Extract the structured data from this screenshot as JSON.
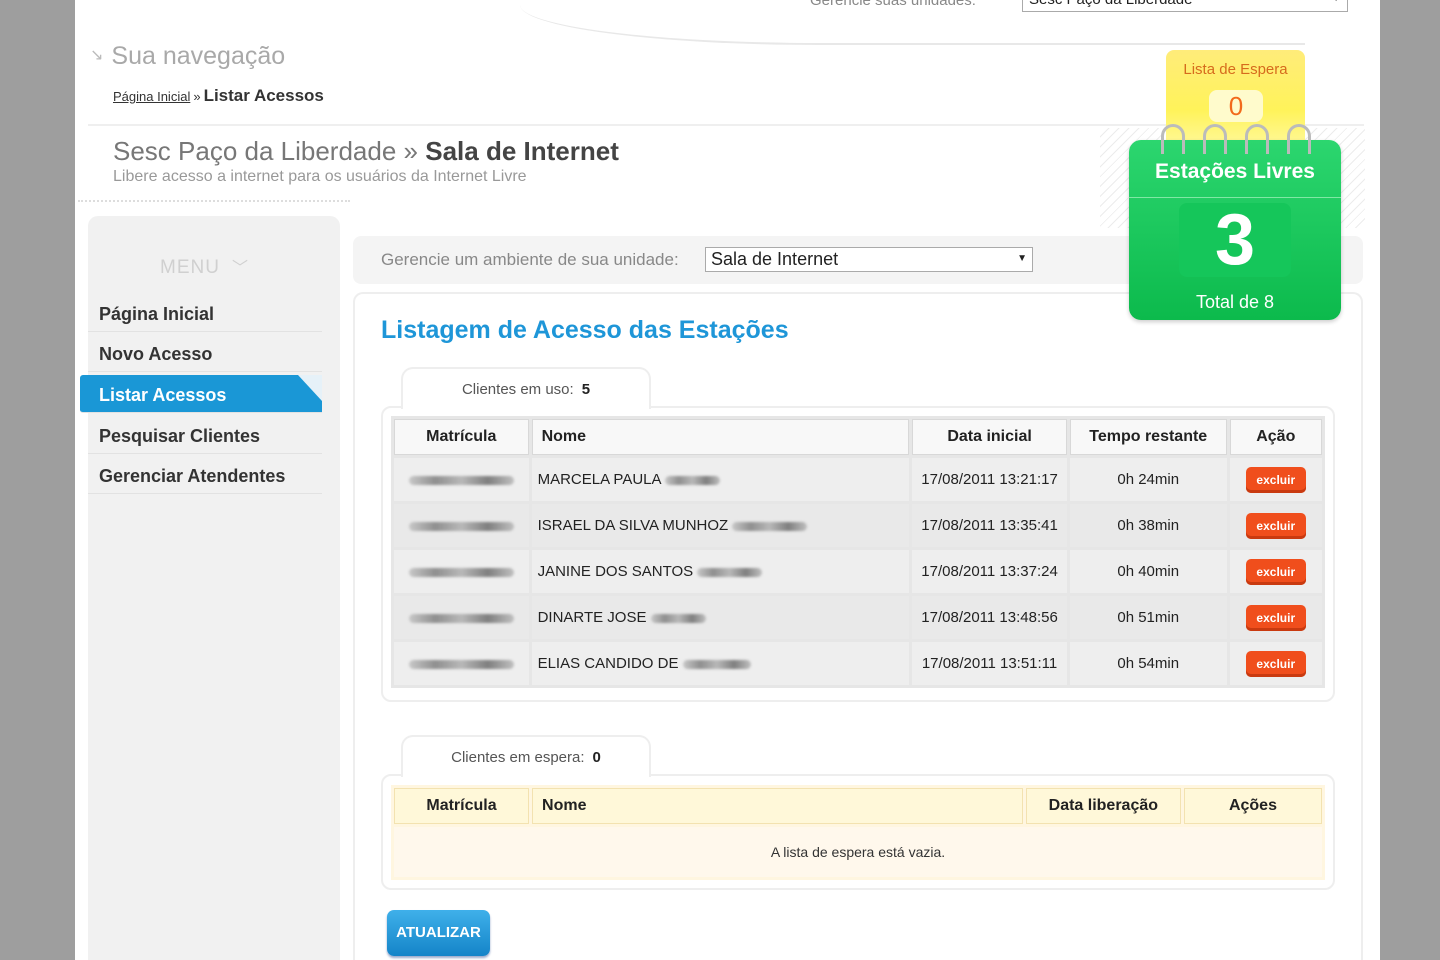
{
  "top_bar": {
    "unit_label": "Gerencie suas unidades:",
    "unit_selected": "Sesc Paço da Liberdade"
  },
  "navigation": {
    "title": "Sua navegação",
    "breadcrumb_home": "Página Inicial",
    "breadcrumb_sep": "»",
    "breadcrumb_current": "Listar Acessos"
  },
  "header": {
    "unit": "Sesc Paço da Liberdade",
    "sep": "»",
    "room": "Sala de Internet",
    "subtitle": "Libere acesso a internet para os usuários da Internet Livre"
  },
  "menu": {
    "label": "MENU",
    "items": [
      {
        "label": "Página Inicial"
      },
      {
        "label": "Novo Acesso"
      },
      {
        "label": "Listar Acessos"
      },
      {
        "label": "Pesquisar Clientes"
      },
      {
        "label": "Gerenciar Atendentes"
      }
    ]
  },
  "ambiente": {
    "label": "Gerencie um ambiente de sua unidade:",
    "selected": "Sala de Internet"
  },
  "widgets": {
    "waiting_label": "Lista de Espera",
    "waiting_count": "0",
    "free_label": "Estações Livres",
    "free_count": "3",
    "free_total": "Total de 8"
  },
  "listing": {
    "title": "Listagem de Acesso das Estações",
    "in_use_label": "Clientes em uso:",
    "in_use_count": "5",
    "columns": [
      "Matrícula",
      "Nome",
      "Data inicial",
      "Tempo restante",
      "Ação"
    ],
    "rows": [
      {
        "name": "MARCELA PAULA",
        "start": "17/08/2011 13:21:17",
        "remaining": "0h 24min",
        "action": "excluir"
      },
      {
        "name": "ISRAEL DA SILVA MUNHOZ",
        "start": "17/08/2011 13:35:41",
        "remaining": "0h 38min",
        "action": "excluir"
      },
      {
        "name": "JANINE DOS SANTOS",
        "start": "17/08/2011 13:37:24",
        "remaining": "0h 40min",
        "action": "excluir"
      },
      {
        "name": "DINARTE JOSE",
        "start": "17/08/2011 13:48:56",
        "remaining": "0h 51min",
        "action": "excluir"
      },
      {
        "name": "ELIAS CANDIDO DE",
        "start": "17/08/2011 13:51:11",
        "remaining": "0h 54min",
        "action": "excluir"
      }
    ]
  },
  "waiting": {
    "label": "Clientes em espera:",
    "count": "0",
    "columns": [
      "Matrícula",
      "Nome",
      "Data liberação",
      "Ações"
    ],
    "empty_message": "A lista de espera está vazia."
  },
  "buttons": {
    "refresh": "ATUALIZAR"
  },
  "colors": {
    "accent_blue": "#1a97d6",
    "title_blue": "#1e96d8",
    "free_green": "#0cba4c",
    "waiting_yellow": "#fff35a",
    "delete_orange": "#f04e1c"
  }
}
